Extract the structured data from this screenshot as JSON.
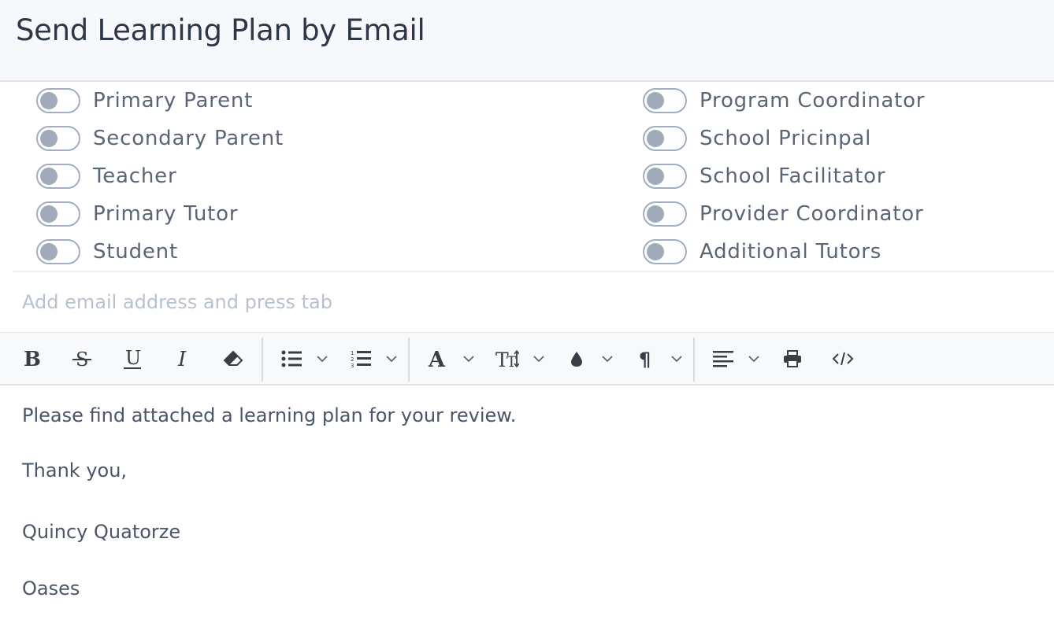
{
  "modal": {
    "title": "Send Learning Plan by Email"
  },
  "recipients": {
    "left": [
      {
        "label": "Primary Parent",
        "enabled": false
      },
      {
        "label": "Secondary Parent",
        "enabled": false
      },
      {
        "label": "Teacher",
        "enabled": false
      },
      {
        "label": "Primary Tutor",
        "enabled": false
      },
      {
        "label": "Student",
        "enabled": false
      }
    ],
    "right": [
      {
        "label": "Program Coordinator",
        "enabled": false
      },
      {
        "label": "School Pricinpal",
        "enabled": false
      },
      {
        "label": "School Facilitator",
        "enabled": false
      },
      {
        "label": "Provider Coordinator",
        "enabled": false
      },
      {
        "label": "Additional Tutors",
        "enabled": false
      }
    ]
  },
  "email_input": {
    "placeholder": "Add email address and press tab",
    "value": ""
  },
  "toolbar": {
    "icons": [
      "bold-icon",
      "strikethrough-icon",
      "underline-icon",
      "italic-icon",
      "eraser-icon",
      "unordered-list-icon",
      "ordered-list-icon",
      "font-color-icon",
      "font-size-icon",
      "highlight-color-icon",
      "paragraph-style-icon",
      "align-icon",
      "print-icon",
      "code-view-icon"
    ]
  },
  "editor": {
    "lines": [
      "Please find attached a learning plan for your review.",
      "Thank you,",
      "Quincy Quatorze",
      "Oases"
    ]
  },
  "colors": {
    "header_bg": "#f7f8fc",
    "toggle_off": "#a0aab8",
    "text": "#4a5568",
    "placeholder": "#b8c2ce"
  }
}
